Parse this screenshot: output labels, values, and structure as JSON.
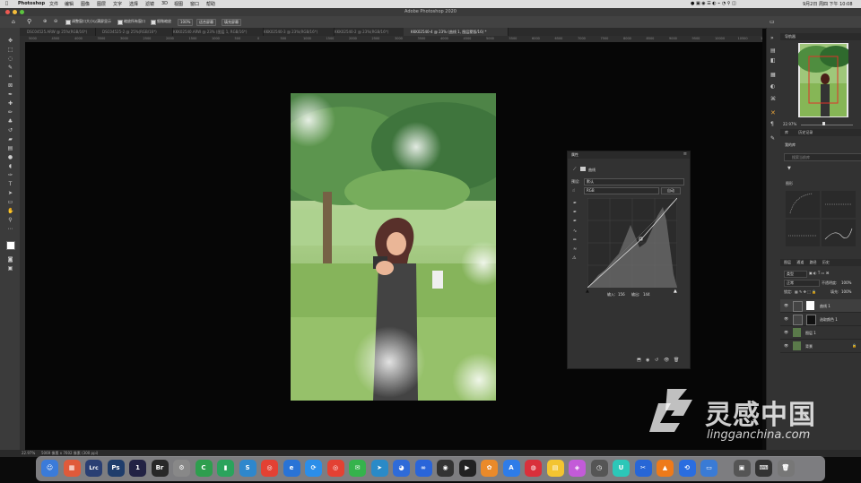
{
  "menubar": {
    "items": [
      "Photoshop",
      "文件",
      "编辑",
      "图像",
      "图层",
      "文字",
      "选择",
      "滤镜",
      "3D",
      "视图",
      "窗口",
      "帮助"
    ],
    "clock": "9月2日 周四 下午 10:08"
  },
  "window": {
    "title": "Adobe Photoshop 2020"
  },
  "options": {
    "resize_windows": "调整窗口大小以满屏显示",
    "zoom_all": "缩放所有窗口",
    "scrubby": "细微缩放",
    "zoom100": "100%",
    "fit_screen": "适合屏幕",
    "fill_screen": "填充屏幕"
  },
  "tabs": [
    "DSC04525.ARW @ 25%(RGB/16*)",
    "DSC04525-2 @ 25%(RGB/16*)",
    "KKK02540.ARW @ 23% (图层 1, RGB/16*)",
    "KKK02540-3 @ 23%(RGB/16*)",
    "KKK02540-2 @ 23%(RGB/16*)",
    "KKK02540-4 @ 23% (曲线 1, 图层蒙版/16) *"
  ],
  "ruler_ticks": [
    "5000",
    "4500",
    "4000",
    "3500",
    "3000",
    "2500",
    "2000",
    "1500",
    "1000",
    "500",
    "0",
    "500",
    "1000",
    "1500",
    "2000",
    "2500",
    "3000",
    "3500",
    "4000",
    "4500",
    "5000",
    "5500",
    "6000",
    "6500",
    "7000",
    "7500",
    "8000",
    "8500",
    "9000",
    "9500",
    "10000",
    "10500",
    "11000"
  ],
  "properties": {
    "header": "属性",
    "panel_name": "曲线",
    "preset_label": "预设:",
    "preset_value": "默认",
    "channel": "RGB",
    "auto": "自动",
    "input_label": "输入:",
    "input_value": "156",
    "output_label": "输出:",
    "output_value": "144"
  },
  "navigator": {
    "header": "导航器",
    "zoom": "22.97%"
  },
  "libraries": {
    "header": "库",
    "subheader": "历史记录",
    "panel": "我的库",
    "search_placeholder": "搜索当前库",
    "group": "图形"
  },
  "layers_panel": {
    "tabs": [
      "图层",
      "通道",
      "路径",
      "历史"
    ],
    "kind": "类型",
    "blend": "正常",
    "opacity_label": "不透明度:",
    "opacity": "100%",
    "lock_label": "锁定:",
    "fill_label": "填充:",
    "fill": "100%",
    "layers": [
      {
        "name": "曲线 1"
      },
      {
        "name": "选取颜色 1"
      },
      {
        "name": "图层 1"
      },
      {
        "name": "背景"
      }
    ]
  },
  "status": {
    "zoom": "22.97%",
    "doc": "5069 像素 x 7602 像素 (300 ppi)"
  },
  "watermark": {
    "name": "灵感中国",
    "url": "lingganchina.com"
  },
  "dock": {
    "icons": [
      "Finder",
      "Launchpad",
      "Lrc",
      "Ps",
      "1",
      "Br",
      "Settings",
      "C",
      "Numbers",
      "S",
      "Chrome",
      "Edge",
      "Translate",
      "Chrome",
      "WeChat",
      "Mail",
      "QQ",
      "Baidu",
      "OBS",
      "iTerm",
      "Photos",
      "App Store",
      "Netease",
      "Notes",
      "Rainbow",
      "Clock",
      "U",
      "Capture",
      "VLC",
      "Link",
      "Folder",
      "Monitor",
      "Keyboard",
      "Trash"
    ],
    "colors": [
      "#3b7bd9",
      "#e05a3a",
      "#2a3f73",
      "#1f3d6b",
      "#222244",
      "#282828",
      "#888888",
      "#2e9e4e",
      "#2aa35c",
      "#2e87cc",
      "#e34133",
      "#2973d6",
      "#2b8ee9",
      "#e34133",
      "#35b34c",
      "#2a8ac7",
      "#2e6bd8",
      "#2a65d9",
      "#333333",
      "#222222",
      "#ea8a2a",
      "#2e7ce8",
      "#d9303b",
      "#f3c431",
      "#c35bd8",
      "#555555",
      "#2cc7b8",
      "#2766d6",
      "#ee7a1a",
      "#2a6de0",
      "#3a7bd5",
      "#555555",
      "#333333",
      "#777777"
    ]
  }
}
